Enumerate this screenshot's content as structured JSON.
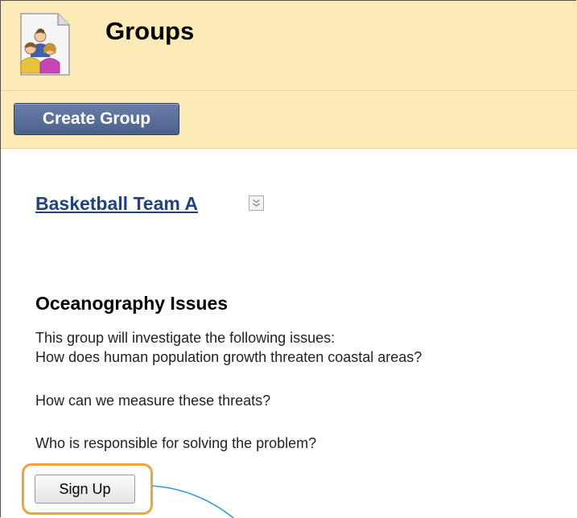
{
  "header": {
    "title": "Groups",
    "icon": "groups-icon"
  },
  "toolbar": {
    "create_group_label": "Create Group"
  },
  "groups": [
    {
      "name": "Basketball Team A",
      "menu_icon": "chevron-down-icon"
    }
  ],
  "signup_group": {
    "title": "Oceanography Issues",
    "description_lines": [
      "This group will investigate the following issues:",
      "How does human population growth threaten coastal areas?",
      "How can we measure these threats?",
      "Who is responsible for solving the problem?"
    ],
    "signup_label": "Sign Up"
  },
  "colors": {
    "header_bg": "#fcebb6",
    "button_blue": "#4b618d",
    "link_blue": "#1d4385",
    "highlight_orange": "#f0a637"
  }
}
